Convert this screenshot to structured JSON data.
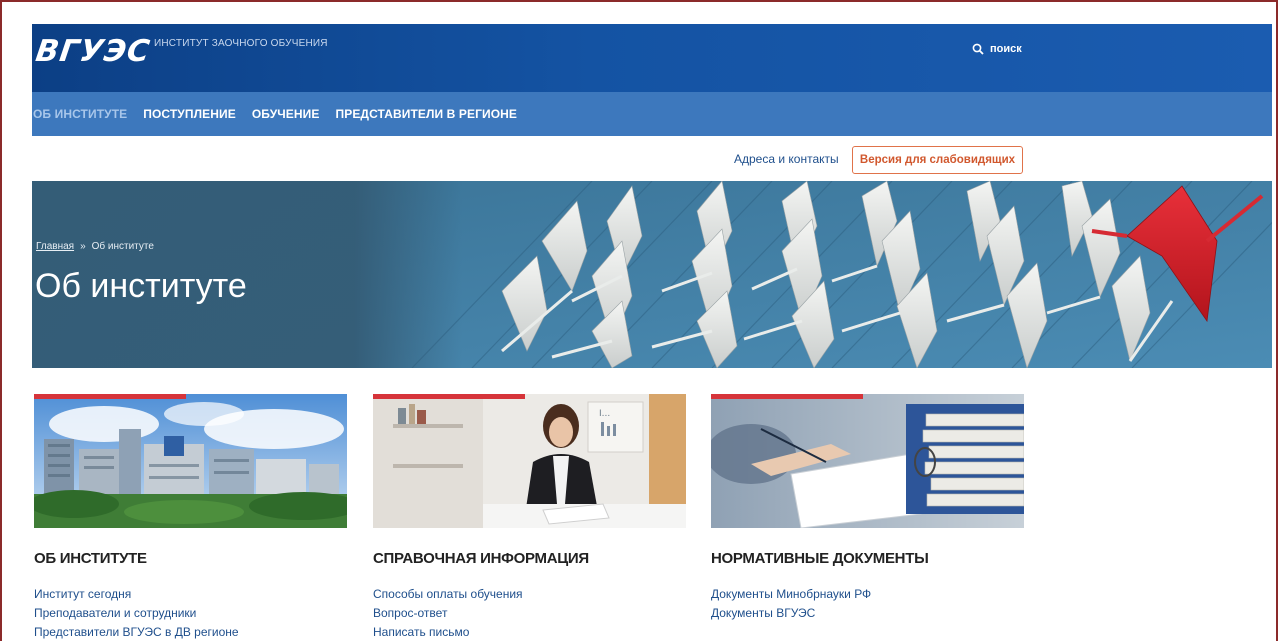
{
  "header": {
    "logo": "ВГУЭС",
    "subtitle": "ИНСТИТУТ ЗАОЧНОГО ОБУЧЕНИЯ",
    "search_label": "поиск"
  },
  "nav": {
    "items": [
      {
        "label": "ОБ ИНСТИТУТЕ",
        "active": true
      },
      {
        "label": "ПОСТУПЛЕНИЕ",
        "active": false
      },
      {
        "label": "ОБУЧЕНИЕ",
        "active": false
      },
      {
        "label": "ПРЕДСТАВИТЕЛИ В РЕГИОНЕ",
        "active": false
      }
    ]
  },
  "utility": {
    "contacts_link": "Адреса и контакты",
    "low_vision_button": "Версия для слабовидящих"
  },
  "hero": {
    "breadcrumb": {
      "home": "Главная",
      "separator": "»",
      "current": "Об институте"
    },
    "title": "Об институте"
  },
  "cards": [
    {
      "heading": "ОБ ИНСТИТУТЕ",
      "links": [
        "Институт сегодня",
        "Преподаватели и сотрудники",
        "Представители ВГУЭС в ДВ регионе"
      ]
    },
    {
      "heading": "СПРАВОЧНАЯ ИНФОРМАЦИЯ",
      "links": [
        "Способы оплаты обучения",
        "Вопрос-ответ",
        "Написать письмо"
      ]
    },
    {
      "heading": "НОРМАТИВНЫЕ ДОКУМЕНТЫ",
      "links": [
        "Документы Минобрнауки РФ",
        "Документы ВГУЭС"
      ]
    }
  ],
  "colors": {
    "header_blue": "#1453a3",
    "nav_blue": "#3d78bd",
    "accent_red": "#d6343a",
    "accent_orange": "#e0734a",
    "link_blue": "#1f4f8c"
  }
}
